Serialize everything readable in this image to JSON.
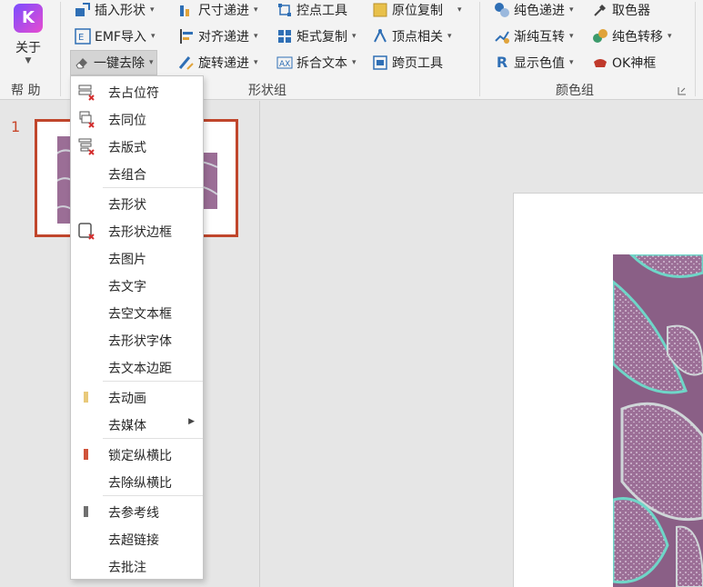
{
  "ribbon": {
    "help_group": {
      "button_label": "关于",
      "group_label": "帮 助"
    },
    "shape_group": {
      "group_label": "形状组",
      "col1": [
        {
          "label": "插入形状",
          "icon": "insert-shape-icon"
        },
        {
          "label": "EMF导入",
          "icon": "emf-import-icon"
        },
        {
          "label": "一键去除",
          "icon": "eraser-icon"
        }
      ],
      "col2": [
        {
          "label": "尺寸递进",
          "icon": "size-step-icon"
        },
        {
          "label": "对齐递进",
          "icon": "align-step-icon"
        },
        {
          "label": "旋转递进",
          "icon": "rotate-step-icon"
        }
      ],
      "col3": [
        {
          "label": "控点工具",
          "icon": "handle-tool-icon"
        },
        {
          "label": "矩式复制",
          "icon": "matrix-copy-icon"
        },
        {
          "label": "拆合文本",
          "icon": "split-text-icon"
        }
      ],
      "col4": [
        {
          "label": "原位复制",
          "icon": "in-place-copy-icon"
        },
        {
          "label": "顶点相关",
          "icon": "vertex-icon"
        },
        {
          "label": "跨页工具",
          "icon": "cross-page-icon"
        }
      ]
    },
    "color_group": {
      "group_label": "颜色组",
      "col1": [
        {
          "label": "纯色递进",
          "icon": "solid-color-step-icon"
        },
        {
          "label": "渐纯互转",
          "icon": "gradient-convert-icon"
        },
        {
          "label": "显示色值",
          "icon": "show-color-value-icon"
        }
      ],
      "col2": [
        {
          "label": "取色器",
          "icon": "eyedropper-icon"
        },
        {
          "label": "纯色转移",
          "icon": "color-transfer-icon"
        },
        {
          "label": "OK神框",
          "icon": "ok-frame-icon"
        }
      ]
    }
  },
  "slides_panel": {
    "slide_number": "1"
  },
  "dropdown_menu": {
    "items": [
      {
        "label": "去占位符",
        "icon": "remove-placeholder-icon"
      },
      {
        "label": "去同位",
        "icon": "remove-same-position-icon"
      },
      {
        "label": "去版式",
        "icon": "remove-layout-icon"
      },
      {
        "label": "去组合",
        "icon": ""
      },
      {
        "label": "去形状",
        "icon": ""
      },
      {
        "label": "去形状边框",
        "icon": "remove-shape-border-icon"
      },
      {
        "label": "去图片",
        "icon": ""
      },
      {
        "label": "去文字",
        "icon": ""
      },
      {
        "label": "去空文本框",
        "icon": ""
      },
      {
        "label": "去形状字体",
        "icon": ""
      },
      {
        "label": "去文本边距",
        "icon": ""
      },
      {
        "label": "去动画",
        "icon": "animation-marker-icon"
      },
      {
        "label": "去媒体",
        "icon": "",
        "has_submenu": true
      },
      {
        "label": "锁定纵横比",
        "icon": "lock-aspect-marker-icon"
      },
      {
        "label": "去除纵横比",
        "icon": ""
      },
      {
        "label": "去参考线",
        "icon": "guide-marker-icon"
      },
      {
        "label": "去超链接",
        "icon": ""
      },
      {
        "label": "去批注",
        "icon": ""
      }
    ]
  },
  "colors": {
    "accent_red": "#c0462c",
    "tissue_purple": "#9b6e96",
    "tissue_teal": "#6fd6c8"
  }
}
